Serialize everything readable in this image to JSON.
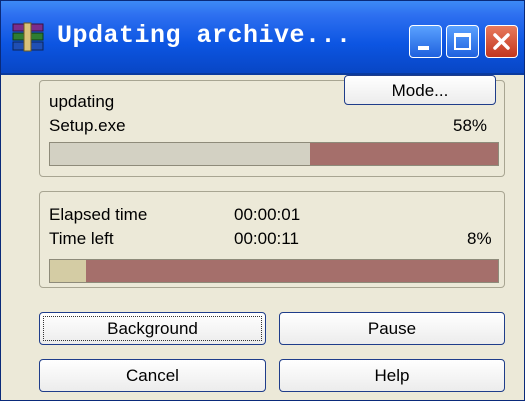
{
  "window": {
    "title": "Updating archive...",
    "icon": "winrar-books-icon"
  },
  "titlebar_buttons": {
    "minimize": "minimize-icon",
    "maximize": "maximize-icon",
    "close": "close-icon"
  },
  "mode_button": {
    "label": "Mode..."
  },
  "current_file": {
    "status": "updating",
    "filename": "Setup.exe",
    "percent_label": "58%",
    "progress_fraction": 0.58
  },
  "overall": {
    "elapsed_label": "Elapsed time",
    "elapsed_value": "00:00:01",
    "left_label": "Time left",
    "left_value": "00:00:11",
    "percent_label": "8%",
    "progress_fraction": 0.08
  },
  "buttons": {
    "background": "Background",
    "pause": "Pause",
    "cancel": "Cancel",
    "help": "Help"
  },
  "colors": {
    "titlebar": "#0c55e2",
    "dialog": "#ECE9D8",
    "bar_track": "#a56f6b"
  }
}
